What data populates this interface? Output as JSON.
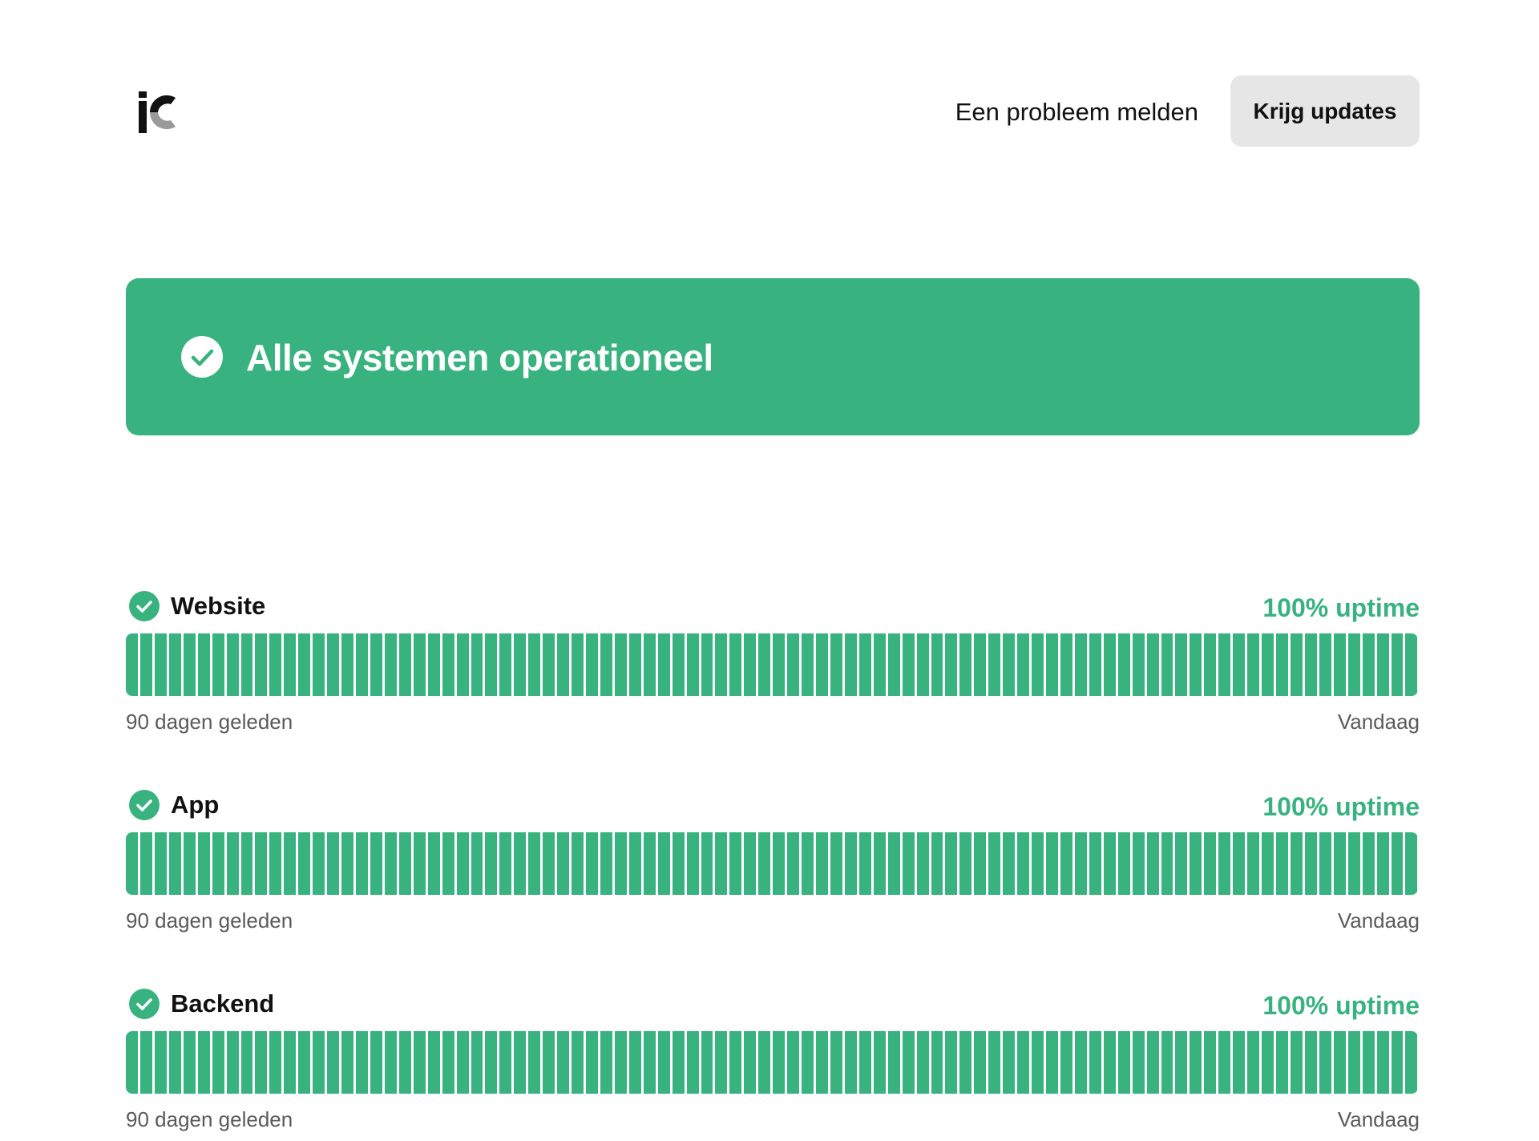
{
  "header": {
    "report_label": "Een probleem melden",
    "updates_label": "Krijg updates"
  },
  "banner": {
    "status_text": "Alle systemen operationeel",
    "color": "#38b27f"
  },
  "colors": {
    "operational": "#38b27f",
    "button_bg": "#e6e6e6",
    "muted_text": "#5a5a5a"
  },
  "components": [
    {
      "name": "Website",
      "uptime": "100% uptime",
      "days_shown": 90,
      "start_label": "90 dagen geleden",
      "end_label": "Vandaag",
      "status_icon": "check-circle-icon"
    },
    {
      "name": "App",
      "uptime": "100% uptime",
      "days_shown": 90,
      "start_label": "90 dagen geleden",
      "end_label": "Vandaag",
      "status_icon": "check-circle-icon"
    },
    {
      "name": "Backend",
      "uptime": "100% uptime",
      "days_shown": 90,
      "start_label": "90 dagen geleden",
      "end_label": "Vandaag",
      "status_icon": "check-circle-icon"
    }
  ]
}
